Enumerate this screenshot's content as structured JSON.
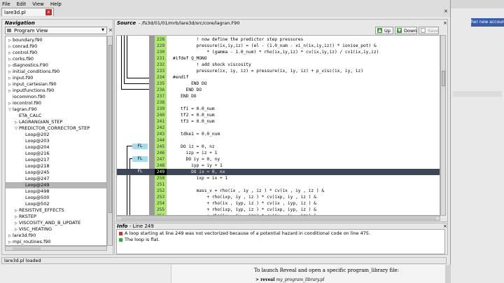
{
  "menu": [
    "File",
    "Edit",
    "View",
    "Help"
  ],
  "tab": {
    "label": "lare3d.pl",
    "close": "x"
  },
  "nav": {
    "title": "Navigation",
    "select": "Program View",
    "items": [
      {
        "label": "boundary.f90",
        "depth": 0,
        "tw": "▷"
      },
      {
        "label": "conrad.f90",
        "depth": 0,
        "tw": "▷"
      },
      {
        "label": "control.f90",
        "depth": 0,
        "tw": "▷"
      },
      {
        "label": "corks.f90",
        "depth": 0,
        "tw": "▷"
      },
      {
        "label": "diagnostics.F90",
        "depth": 0,
        "tw": "▷"
      },
      {
        "label": "initial_conditions.f90",
        "depth": 0,
        "tw": "▷"
      },
      {
        "label": "input.f90",
        "depth": 0,
        "tw": "▷"
      },
      {
        "label": "input_cartesian.f90",
        "depth": 0,
        "tw": "▷"
      },
      {
        "label": "inputfunctions.f90",
        "depth": 0,
        "tw": "▷"
      },
      {
        "label": "iocommon.f90",
        "depth": 0,
        "tw": ""
      },
      {
        "label": "iocontrol.f90",
        "depth": 0,
        "tw": "▷"
      },
      {
        "label": "lagran.F90",
        "depth": 0,
        "tw": "▽"
      },
      {
        "label": "ETA_CALC",
        "depth": 1,
        "tw": ""
      },
      {
        "label": "LAGRANGIAN_STEP",
        "depth": 1,
        "tw": "▷"
      },
      {
        "label": "PREDICTOR_CORRECTOR_STEP",
        "depth": 1,
        "tw": "▽"
      },
      {
        "label": "Loop@202",
        "depth": 2,
        "tw": ""
      },
      {
        "label": "Loop@203",
        "depth": 2,
        "tw": ""
      },
      {
        "label": "Loop@204",
        "depth": 2,
        "tw": ""
      },
      {
        "label": "Loop@216",
        "depth": 2,
        "tw": ""
      },
      {
        "label": "Loop@217",
        "depth": 2,
        "tw": ""
      },
      {
        "label": "Loop@218",
        "depth": 2,
        "tw": ""
      },
      {
        "label": "Loop@245",
        "depth": 2,
        "tw": ""
      },
      {
        "label": "Loop@247",
        "depth": 2,
        "tw": ""
      },
      {
        "label": "Loop@249",
        "depth": 2,
        "tw": "",
        "selected": true
      },
      {
        "label": "Loop@498",
        "depth": 2,
        "tw": ""
      },
      {
        "label": "Loop@500",
        "depth": 2,
        "tw": ""
      },
      {
        "label": "Loop@502",
        "depth": 2,
        "tw": ""
      },
      {
        "label": "RESISTIVE_EFFECTS",
        "depth": 1,
        "tw": "▷"
      },
      {
        "label": "RKSTEP",
        "depth": 1,
        "tw": "▷"
      },
      {
        "label": "VISCOSITY_AND_B_UPDATE",
        "depth": 1,
        "tw": "▷"
      },
      {
        "label": "VISC_HEATING",
        "depth": 1,
        "tw": "▷"
      },
      {
        "label": "lare3d.f90",
        "depth": 0,
        "tw": "▷"
      },
      {
        "label": "mpi_routines.f90",
        "depth": 0,
        "tw": "▷"
      },
      {
        "label": "mpiboundary.f90",
        "depth": 0,
        "tw": "▷"
      },
      {
        "label": "neutral.f90",
        "depth": 0,
        "tw": "▷"
      }
    ]
  },
  "source": {
    "title": "Source",
    "path": "- /fs3d/01/01/mrb/lare3d/src/core/lagran.F90",
    "buttons": {
      "up": "Up",
      "down": "Down",
      "save": "Save"
    },
    "lines": [
      {
        "n": "228",
        "t": "         ! now define the predictor step pressures"
      },
      {
        "n": "229",
        "t": "         pressure(ix,iy,iz) = (el - (1.0_num - xi_n(ix,iy,iz)) * ionise_pot) &"
      },
      {
        "n": "230",
        "t": "             * (gamma - 1.0_num) * rho(ix,iy,iz) * cv(ix,iy,iz) / cv1(ix,iy,iz)"
      },
      {
        "n": "231",
        "t": "#ifdef Q_MONO"
      },
      {
        "n": "232",
        "t": "         ! add shock viscosity"
      },
      {
        "n": "233",
        "t": "         pressure(ix, iy, iz) = pressure(ix, iy, iz) + p_visc(ix, iy, iz)"
      },
      {
        "n": "234",
        "t": "#endif"
      },
      {
        "n": "235",
        "t": "       END DO"
      },
      {
        "n": "236",
        "t": "     END DO"
      },
      {
        "n": "237",
        "t": "   END DO"
      },
      {
        "n": "238",
        "t": ""
      },
      {
        "n": "239",
        "t": "   tf1 = 0.0_num"
      },
      {
        "n": "240",
        "t": "   tf2 = 0.0_num"
      },
      {
        "n": "241",
        "t": "   tf3 = 0.0_num"
      },
      {
        "n": "242",
        "t": ""
      },
      {
        "n": "243",
        "t": "   tdke1 = 0.0_num"
      },
      {
        "n": "244",
        "t": ""
      },
      {
        "n": "245",
        "t": "   DO iz = 0, nz",
        "fl": "FL"
      },
      {
        "n": "246",
        "t": "     izp = iz + 1"
      },
      {
        "n": "247",
        "t": "     DO iy = 0, ny",
        "fl": "FL"
      },
      {
        "n": "248",
        "t": "       iyp = iy + 1"
      },
      {
        "n": "249",
        "t": "       DO ix = 0, nx",
        "fl": "FL",
        "current": true
      },
      {
        "n": "250",
        "t": "         ixp = ix + 1"
      },
      {
        "n": "251",
        "t": ""
      },
      {
        "n": "252",
        "t": "         mass_v = rho(ix , iy , iz ) * cv(ix , iy , iz ) &"
      },
      {
        "n": "253",
        "t": "             + rho(ixp, iy , iz ) * cv(ixp, iy , iz ) &"
      },
      {
        "n": "254",
        "t": "             + rho(ix , iyp, iz ) * cv(ix , iyp, iz ) &"
      },
      {
        "n": "255",
        "t": "             + rho(ixp, iyp, iz ) * cv(ixp, iyp, iz ) &"
      },
      {
        "n": "256",
        "t": "             + rho(ix , iy , izp) * cv(ix , iy , izp) &"
      }
    ]
  },
  "info": {
    "title": "Info",
    "subtitle": "- Line 249",
    "messages": [
      {
        "text": "A loop starting at line 249 was not vectorized because of a potential hazard in conditional code on line 475.",
        "color": "#d03030"
      },
      {
        "text": "The loop is flat.",
        "color": "#36a836"
      }
    ]
  },
  "status": "lare3d.pl loaded",
  "background": {
    "link": "her new account",
    "doc_text": "To launch Reveal and open a specific program_library file:",
    "doc_cmd": "reveal",
    "doc_arg": "my_program_library.pl"
  }
}
